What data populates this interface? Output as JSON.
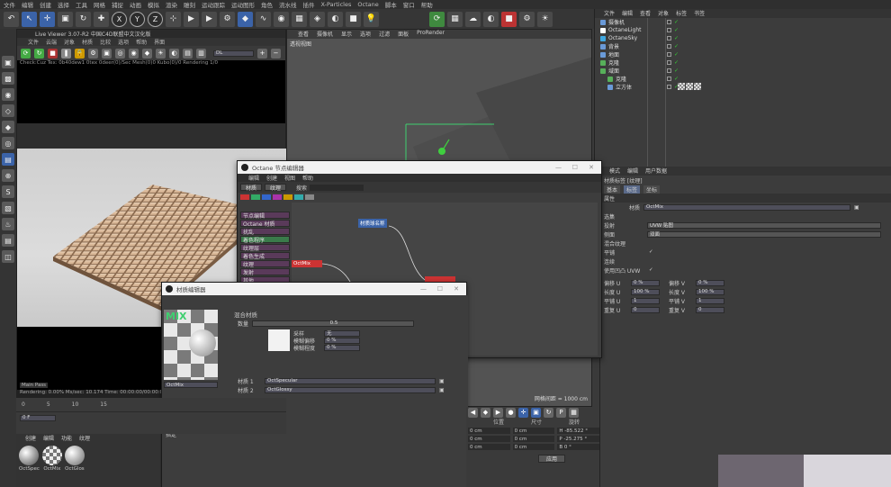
{
  "menubar": [
    "文件",
    "编辑",
    "创建",
    "选择",
    "工具",
    "网格",
    "捕捉",
    "动画",
    "模拟",
    "渲染",
    "雕刻",
    "运动跟踪",
    "运动图形",
    "角色",
    "流水线",
    "插件",
    "X-Particles",
    "Octane",
    "脚本",
    "窗口",
    "帮助"
  ],
  "toolbar": {
    "axes": [
      "X",
      "Y",
      "Z"
    ]
  },
  "live_viewer": {
    "title": "Live Viewer 3.07-R2 中国C4D联盟中文汉化版",
    "menu": [
      "文件",
      "云端",
      "对象",
      "材质",
      "比较",
      "选项",
      "帮助",
      "界面"
    ],
    "preset": "DL",
    "info": "Check:Cuz  Tex: 0b40dew1 0tex 0deer(0)/Sec  Mesh(0)0 Kubo(0)/0 Rendering 1/0",
    "stream": "Main Pass",
    "status": "Rendering: 0.00%   Ms/sec: 10.174   Time: 00:00:00/00:00:00"
  },
  "viewport": {
    "menu": [
      "查看",
      "摄像机",
      "显示",
      "选项",
      "过滤",
      "面板",
      "ProRender"
    ],
    "label": "透视视图",
    "grid_info": "网格间距 = 1000 cm"
  },
  "object_manager": {
    "menu": [
      "文件",
      "编辑",
      "查看",
      "对象",
      "标签",
      "书签"
    ],
    "objects": [
      {
        "name": "摄像机",
        "color": "#6a9ad8"
      },
      {
        "name": "OctaneLight",
        "color": "#ffffff"
      },
      {
        "name": "OctaneSky",
        "color": "#3fa7e0"
      },
      {
        "name": "背景",
        "color": "#6a9ad8"
      },
      {
        "name": "地面",
        "color": "#6a9ad8"
      },
      {
        "name": "克隆",
        "color": "#57b05a"
      },
      {
        "name": "域面",
        "color": "#57b05a"
      },
      {
        "name": "克隆",
        "color": "#57b05a"
      },
      {
        "name": "立方体",
        "color": "#6a9ad8"
      }
    ]
  },
  "attributes": {
    "menu": [
      "模式",
      "编辑",
      "用户数据"
    ],
    "title": "材质标签 [纹理]",
    "tabs": [
      "基本",
      "标签",
      "坐标"
    ],
    "section": "属性",
    "material_label": "材质",
    "material_value": "OctMix",
    "rows": [
      {
        "label": "选集",
        "value": ""
      },
      {
        "label": "投射",
        "value": "UVW 贴图"
      },
      {
        "label": "侧面",
        "value": "双面"
      },
      {
        "label": "混合纹理",
        "value": ""
      },
      {
        "label": "平铺",
        "value": "✓"
      },
      {
        "label": "连续",
        "value": ""
      },
      {
        "label": "使用凹凸 UVW",
        "value": "✓"
      }
    ],
    "offset": [
      {
        "l1": "偏移 U",
        "v1": "0 %",
        "l2": "偏移 V",
        "v2": "0 %"
      },
      {
        "l1": "长度 U",
        "v1": "100 %",
        "l2": "长度 V",
        "v2": "100 %"
      },
      {
        "l1": "平铺 U",
        "v1": "1",
        "l2": "平铺 V",
        "v2": "1"
      },
      {
        "l1": "重复 U",
        "v1": "0",
        "l2": "重复 V",
        "v2": "0"
      }
    ]
  },
  "node_editor": {
    "title": "Octane 节点编辑器",
    "menu": [
      "编辑",
      "创建",
      "视图",
      "帮助"
    ],
    "buttons": [
      "材质",
      "纹理"
    ],
    "search_label": "搜索",
    "categories": [
      "节点编辑",
      "Octane 材质",
      "扰乱",
      "着色程序",
      "纹理层",
      "着色生成",
      "纹理",
      "发射",
      "其他"
    ],
    "node_label": "材质球名称",
    "mix_label": "OctMix"
  },
  "material_editor": {
    "title": "材质编辑器",
    "node_name": "OctMix",
    "header": "混合材质",
    "amount_label": "数量",
    "amount_value": "0.5",
    "texture_label": "纹理",
    "sub_rows": [
      {
        "label": "采样",
        "value": "无"
      },
      {
        "label": "模糊偏移",
        "value": "0 %"
      },
      {
        "label": "模糊程度",
        "value": "0 %"
      }
    ],
    "materials": [
      {
        "label": "材质 1",
        "value": "OctSpecular"
      },
      {
        "label": "材质 2",
        "value": "OctGlossy"
      }
    ],
    "menu_items": [
      "混合材质",
      "混合材质",
      "使用通道",
      "编辑",
      "指定"
    ]
  },
  "timeline": {
    "frame": "0 F",
    "ticks": [
      "0",
      "5",
      "10",
      "15"
    ]
  },
  "material_manager": {
    "menu": [
      "创建",
      "编辑",
      "功能",
      "纹理"
    ],
    "materials": [
      "OctSpec",
      "OctMix",
      "OctGlos"
    ]
  },
  "coordinates": {
    "headers": [
      "位置",
      "尺寸",
      "旋转"
    ],
    "rows": [
      {
        "a": "0 cm",
        "b": "0 cm",
        "c": "H -85.522 °"
      },
      {
        "a": "0 cm",
        "b": "0 cm",
        "c": "P -25.275 °"
      },
      {
        "a": "0 cm",
        "b": "0 cm",
        "c": "B 0 °"
      }
    ],
    "apply": "应用"
  }
}
